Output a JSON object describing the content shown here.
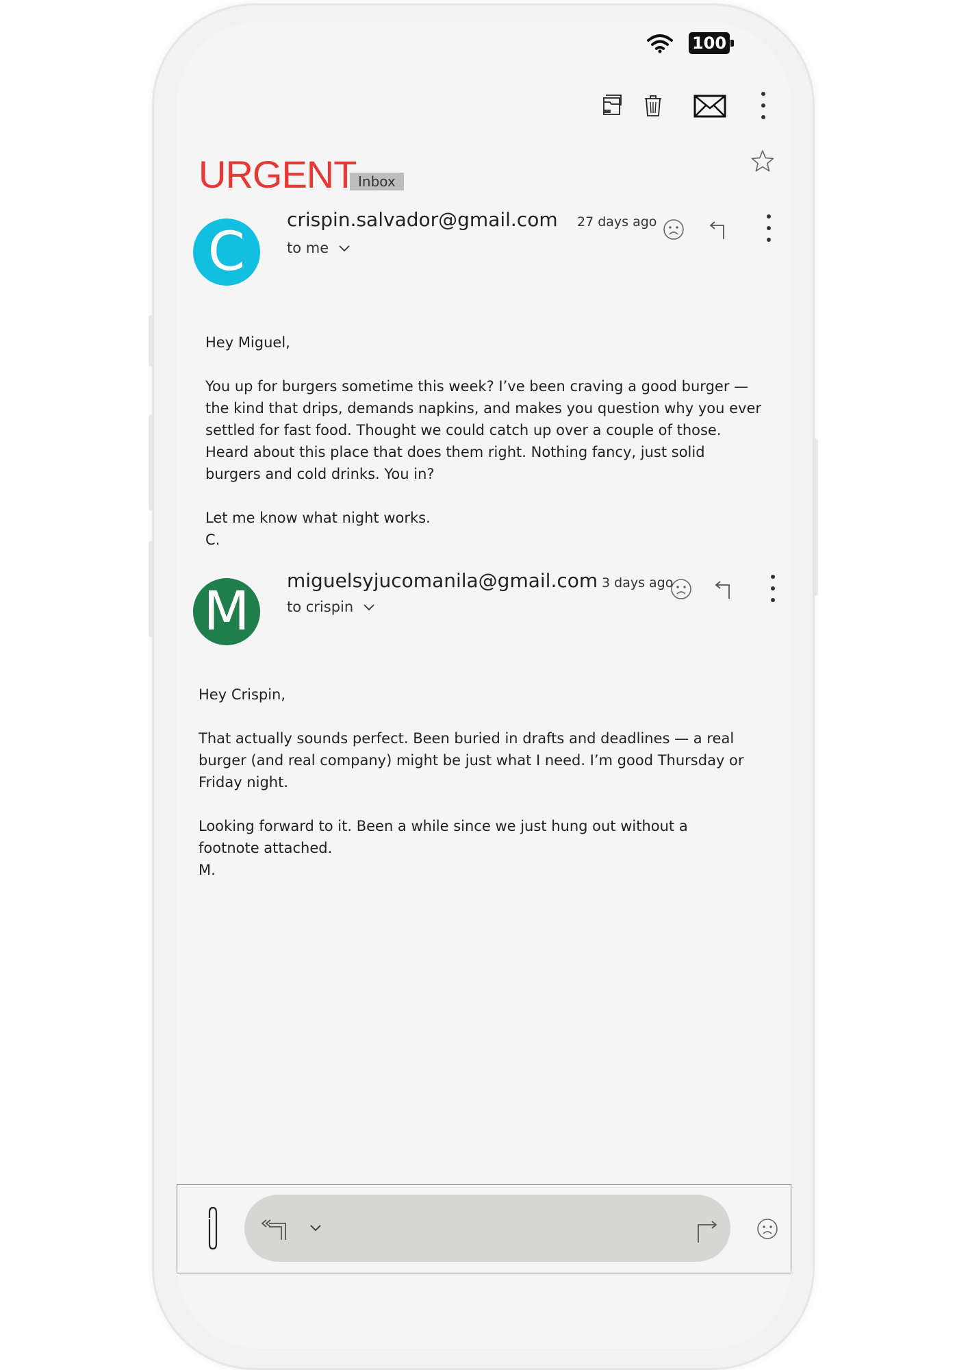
{
  "status": {
    "battery": "100",
    "wifi_icon": "wifi-icon"
  },
  "toolbar": {
    "icons": [
      "archive-icon",
      "trash-icon",
      "mail-icon",
      "more-vert-icon"
    ]
  },
  "thread": {
    "subject": "URGENT",
    "label": "Inbox"
  },
  "messages": [
    {
      "avatar_letter": "C",
      "avatar_color": "#12bfe0",
      "from": "crispin.salvador@gmail.com",
      "time": "27 days ago",
      "to": "to me",
      "body": "Hey Miguel,\n\nYou up for burgers sometime this week? I’ve been craving a good burger —\nthe kind that drips, demands napkins, and makes you question why you ever\nsettled for fast food. Thought we could catch up over a couple of those.\nHeard about this place that does them right. Nothing fancy, just solid\nburgers and cold drinks. You in?\n\nLet me know what night works.\nC."
    },
    {
      "avatar_letter": "M",
      "avatar_color": "#207d4c",
      "from": "miguelsyjucomanila@gmail.com",
      "time": "3 days ago",
      "to": "to crispin",
      "body": "Hey Crispin,\n\nThat actually sounds perfect. Been buried in drafts and deadlines — a real\nburger (and real company) might be just what I need. I’m good Thursday or\nFriday night.\n\nLooking forward to it. Been a while since we just hung out without a\nfootnote attached.\nM."
    }
  ]
}
